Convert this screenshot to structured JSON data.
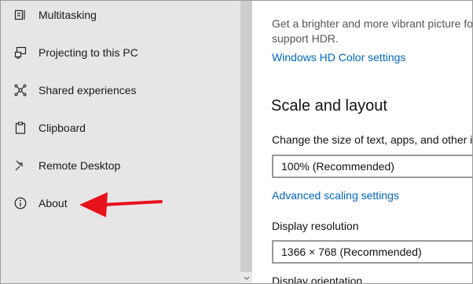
{
  "sidebar": {
    "items": [
      {
        "label": "Multitasking",
        "icon": "multitasking-icon"
      },
      {
        "label": "Projecting to this PC",
        "icon": "projecting-icon"
      },
      {
        "label": "Shared experiences",
        "icon": "shared-experiences-icon"
      },
      {
        "label": "Clipboard",
        "icon": "clipboard-icon"
      },
      {
        "label": "Remote Desktop",
        "icon": "remote-desktop-icon"
      },
      {
        "label": "About",
        "icon": "info-icon"
      }
    ]
  },
  "main": {
    "hdr_description_line1": "Get a brighter and more vibrant picture fo",
    "hdr_description_line2": "support HDR.",
    "hdr_link": "Windows HD Color settings",
    "scale_section_title": "Scale and layout",
    "scale_label": "Change the size of text, apps, and other it",
    "scale_value": "100% (Recommended)",
    "advanced_scaling_link": "Advanced scaling settings",
    "resolution_label": "Display resolution",
    "resolution_value": "1366 × 768 (Recommended)",
    "orientation_label": "Display orientation"
  },
  "annotation": {
    "arrow_color": "#e8121b"
  }
}
